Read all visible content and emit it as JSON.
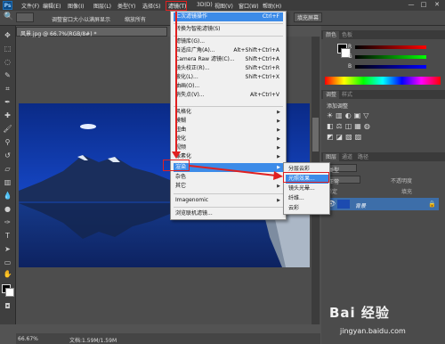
{
  "app": {
    "logo": "Ps"
  },
  "menubar": {
    "items": [
      "文件(F)",
      "编辑(E)",
      "图像(I)",
      "图层(L)",
      "类型(Y)",
      "选择(S)",
      "滤镜(T)",
      "3D(D)",
      "视图(V)",
      "窗口(W)",
      "帮助(H)"
    ],
    "window_controls": [
      "—",
      "□",
      "✕"
    ]
  },
  "optbar": {
    "resize_label": "调整窗口大小以满屏显示",
    "zoom_all_label": "缩放所有",
    "fill_screen_label": "填充屏幕"
  },
  "document": {
    "tab_label": "风景.jpg @ 66.7%(RGB/8#) *",
    "zoom": "66.67%",
    "doc_info": "文档:1.59M/1.59M"
  },
  "edit_menu": {
    "items": [
      {
        "label": "上次滤镜操作",
        "shortcut": "Ctrl+F",
        "highlighted": true
      },
      {
        "label": "转换为智能滤镜(S)"
      },
      {
        "label": "滤镜库(G)..."
      },
      {
        "label": "自适应广角(A)...",
        "shortcut": "Alt+Shift+Ctrl+A"
      },
      {
        "label": "Camera Raw 滤镜(C)...",
        "shortcut": "Shift+Ctrl+A"
      },
      {
        "label": "镜头校正(R)...",
        "shortcut": "Shift+Ctrl+R"
      },
      {
        "label": "液化(L)...",
        "shortcut": "Shift+Ctrl+X"
      },
      {
        "label": "油画(O)..."
      },
      {
        "label": "消失点(V)...",
        "shortcut": "Alt+Ctrl+V"
      },
      {
        "label": "风格化"
      },
      {
        "label": "模糊"
      },
      {
        "label": "扭曲"
      },
      {
        "label": "锐化"
      },
      {
        "label": "视频"
      },
      {
        "label": "像素化"
      },
      {
        "label": "渲染",
        "highlighted": true
      },
      {
        "label": "杂色"
      },
      {
        "label": "其它"
      },
      {
        "label": "Imagenomic"
      },
      {
        "label": "浏览联机滤镜..."
      }
    ]
  },
  "submenu": {
    "items": [
      "分层云彩",
      "光照效果...",
      "镜头光晕...",
      "纤维...",
      "云彩"
    ]
  },
  "right_panel": {
    "color_tabs": [
      "颜色",
      "色板"
    ],
    "color_labels": [
      "R",
      "G",
      "B"
    ],
    "adjust_tabs": [
      "调整",
      "样式"
    ],
    "adjust_title": "添加调整",
    "layer_tabs": [
      "图层",
      "通道",
      "路径"
    ],
    "kind_label": "类型",
    "blend_mode": "正常",
    "opacity_label": "不透明度",
    "lock_label": "锁定",
    "fill_label": "填充",
    "layer_name": "背景"
  },
  "watermark": {
    "brand": "Bai 经验",
    "url": "jingyan.baidu.com"
  },
  "colors": {
    "accent": "#3c8be8",
    "annotation": "#e02020",
    "fg_swatch": "#000000",
    "bg_swatch": "#ffffff"
  }
}
